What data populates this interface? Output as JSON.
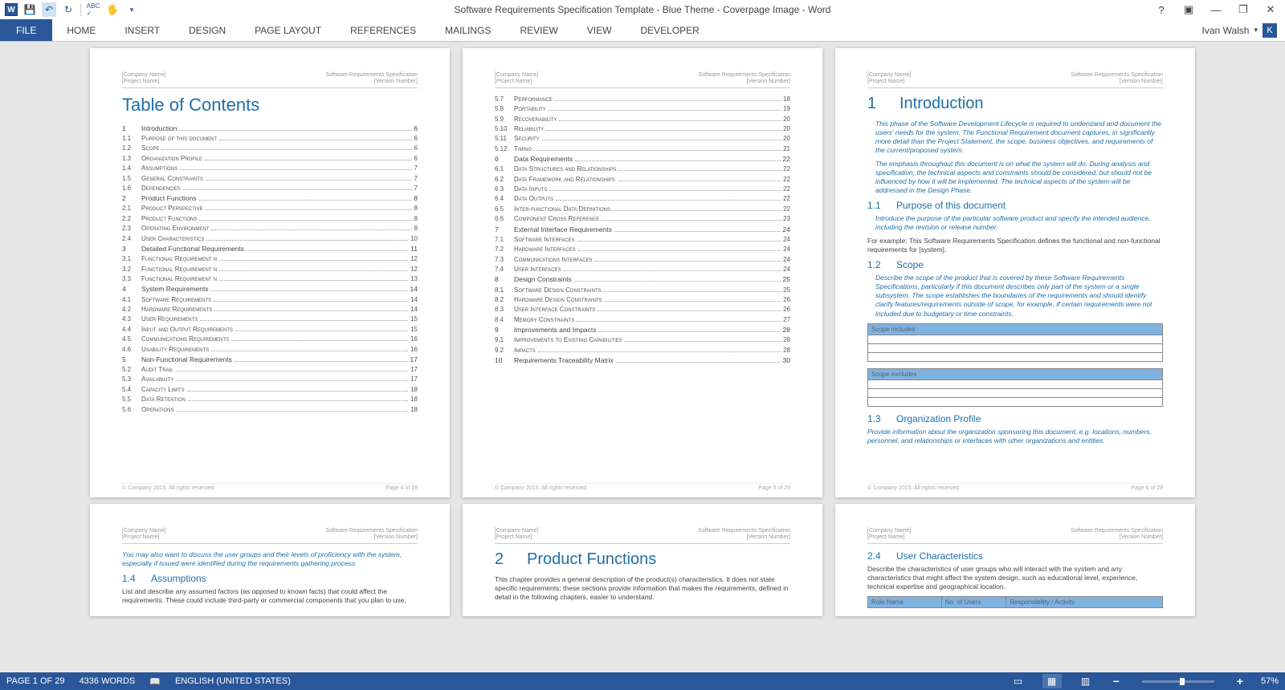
{
  "title": "Software Requirements Specification Template - Blue Theme - Coverpage Image - Word",
  "user": "Ivan Walsh",
  "user_initial": "K",
  "ribbon_tabs": [
    "FILE",
    "HOME",
    "INSERT",
    "DESIGN",
    "PAGE LAYOUT",
    "REFERENCES",
    "MAILINGS",
    "REVIEW",
    "VIEW",
    "DEVELOPER"
  ],
  "header_company": "[Company Name]",
  "header_project": "[Project Name]",
  "header_doc": "Software Requirements Specification",
  "header_version": "[Version Number]",
  "footer_copyright": "© Company 2015. All rights reserved",
  "footer_p4": "Page 4 of 29",
  "footer_p5": "Page 5 of 29",
  "footer_p6": "Page 6 of 29",
  "toc_title": "Table of Contents",
  "toc1": [
    {
      "h": 1,
      "no": "1",
      "lbl": "Introduction",
      "pg": "6"
    },
    {
      "h": 2,
      "no": "1.1",
      "lbl": "Purpose of this document",
      "pg": "6"
    },
    {
      "h": 2,
      "no": "1.2",
      "lbl": "Scope",
      "pg": "6"
    },
    {
      "h": 2,
      "no": "1.3",
      "lbl": "Organization Profile",
      "pg": "6"
    },
    {
      "h": 2,
      "no": "1.4",
      "lbl": "Assumptions",
      "pg": "7"
    },
    {
      "h": 2,
      "no": "1.5",
      "lbl": "General Constraints",
      "pg": "7"
    },
    {
      "h": 2,
      "no": "1.6",
      "lbl": "Dependencies",
      "pg": "7"
    },
    {
      "h": 1,
      "no": "2",
      "lbl": "Product Functions",
      "pg": "8"
    },
    {
      "h": 2,
      "no": "2.1",
      "lbl": "Product Perspective",
      "pg": "8"
    },
    {
      "h": 2,
      "no": "2.2",
      "lbl": "Product Functions",
      "pg": "8"
    },
    {
      "h": 2,
      "no": "2.3",
      "lbl": "Operating Environment",
      "pg": "8"
    },
    {
      "h": 2,
      "no": "2.4",
      "lbl": "User Characteristics",
      "pg": "10"
    },
    {
      "h": 1,
      "no": "3",
      "lbl": "Detailed Functional Requirements",
      "pg": "11"
    },
    {
      "h": 2,
      "no": "3.1",
      "lbl": "Functional Requirement n",
      "pg": "12"
    },
    {
      "h": 2,
      "no": "3.2",
      "lbl": "Functional Requirement n",
      "pg": "12"
    },
    {
      "h": 2,
      "no": "3.3",
      "lbl": "Functional Requirement n",
      "pg": "13"
    },
    {
      "h": 1,
      "no": "4",
      "lbl": "System Requirements",
      "pg": "14"
    },
    {
      "h": 2,
      "no": "4.1",
      "lbl": "Software Requirements",
      "pg": "14"
    },
    {
      "h": 2,
      "no": "4.2",
      "lbl": "Hardware Requirements",
      "pg": "14"
    },
    {
      "h": 2,
      "no": "4.3",
      "lbl": "User Requirements",
      "pg": "15"
    },
    {
      "h": 2,
      "no": "4.4",
      "lbl": "Input and Output Requirements",
      "pg": "15"
    },
    {
      "h": 2,
      "no": "4.5",
      "lbl": "Communications Requirements",
      "pg": "16"
    },
    {
      "h": 2,
      "no": "4.6",
      "lbl": "Usability Requirements",
      "pg": "16"
    },
    {
      "h": 1,
      "no": "5",
      "lbl": "Non-Functional Requirements",
      "pg": "17"
    },
    {
      "h": 2,
      "no": "5.2",
      "lbl": "Audit Trail",
      "pg": "17"
    },
    {
      "h": 2,
      "no": "5.3",
      "lbl": "Availability",
      "pg": "17"
    },
    {
      "h": 2,
      "no": "5.4",
      "lbl": "Capacity Limits",
      "pg": "18"
    },
    {
      "h": 2,
      "no": "5.5",
      "lbl": "Data Retention",
      "pg": "18"
    },
    {
      "h": 2,
      "no": "5.6",
      "lbl": "Operations",
      "pg": "18"
    }
  ],
  "toc2": [
    {
      "h": 2,
      "no": "5.7",
      "lbl": "Performance",
      "pg": "18"
    },
    {
      "h": 2,
      "no": "5.8",
      "lbl": "Portability",
      "pg": "19"
    },
    {
      "h": 2,
      "no": "5.9",
      "lbl": "Recoverability",
      "pg": "20"
    },
    {
      "h": 2,
      "no": "5.10",
      "lbl": "Reliability",
      "pg": "20"
    },
    {
      "h": 2,
      "no": "5.11",
      "lbl": "Security",
      "pg": "20"
    },
    {
      "h": 2,
      "no": "5.12",
      "lbl": "Timing",
      "pg": "21"
    },
    {
      "h": 1,
      "no": "6",
      "lbl": "Data Requirements",
      "pg": "22"
    },
    {
      "h": 2,
      "no": "6.1",
      "lbl": "Data Structures and Relationships",
      "pg": "22"
    },
    {
      "h": 2,
      "no": "6.2",
      "lbl": "Data Framework and Relationships",
      "pg": "22"
    },
    {
      "h": 2,
      "no": "6.3",
      "lbl": "Data Inputs",
      "pg": "22"
    },
    {
      "h": 2,
      "no": "6.4",
      "lbl": "Data Outputs",
      "pg": "22"
    },
    {
      "h": 2,
      "no": "6.5",
      "lbl": "Inter-functional Data Definitions",
      "pg": "22"
    },
    {
      "h": 2,
      "no": "6.6",
      "lbl": "Component Cross Reference",
      "pg": "23"
    },
    {
      "h": 1,
      "no": "7",
      "lbl": "External Interface Requirements",
      "pg": "24"
    },
    {
      "h": 2,
      "no": "7.1",
      "lbl": "Software Interfaces",
      "pg": "24"
    },
    {
      "h": 2,
      "no": "7.2",
      "lbl": "Hardware Interfaces",
      "pg": "24"
    },
    {
      "h": 2,
      "no": "7.3",
      "lbl": "Communications Interfaces",
      "pg": "24"
    },
    {
      "h": 2,
      "no": "7.4",
      "lbl": "User Interfaces",
      "pg": "24"
    },
    {
      "h": 1,
      "no": "8",
      "lbl": "Design Constraints",
      "pg": "25"
    },
    {
      "h": 2,
      "no": "8.1",
      "lbl": "Software Design Constraints",
      "pg": "25"
    },
    {
      "h": 2,
      "no": "8.2",
      "lbl": "Hardware Design Constraints",
      "pg": "26"
    },
    {
      "h": 2,
      "no": "8.3",
      "lbl": "User Interface Constraints",
      "pg": "26"
    },
    {
      "h": 2,
      "no": "8.4",
      "lbl": "Memory Constraints",
      "pg": "27"
    },
    {
      "h": 1,
      "no": "9",
      "lbl": "Improvements and Impacts",
      "pg": "28"
    },
    {
      "h": 2,
      "no": "9.1",
      "lbl": "Improvements to Existing Capabilities",
      "pg": "28"
    },
    {
      "h": 2,
      "no": "9.2",
      "lbl": "Impacts",
      "pg": "28"
    },
    {
      "h": 1,
      "no": "10",
      "lbl": "Requirements Traceability Matrix",
      "pg": "30"
    }
  ],
  "intro": {
    "title": "Introduction",
    "p1": "This phase of the Software Development Lifecycle is required to understand and document the users' needs for the system. The Functional Requirement document captures, in significantly more detail than the Project Statement, the scope, business objectives, and requirements of the current/proposed system.",
    "p2": "The emphasis throughout this document is on what the system will do. During analysis and specification, the technical aspects and constraints should be considered, but should not be influenced by how it will be implemented. The technical aspects of the system will be addressed in the Design Phase.",
    "s11": "Purpose of this document",
    "s11_p": "Introduce the purpose of the particular software product and specify the intended audience, including the revision or release number.",
    "s11_ex": "For example: This Software Requirements Specification defines the functional and non-functional requirements for [system].",
    "s12": "Scope",
    "s12_p": "Describe the scope of the product that is covered by these Software Requirements Specifications, particularly if this document describes only part of the system or a single subsystem. The scope establishes the boundaries of the requirements and should identify clarify features/requirements outside of scope, for example, if certain requirements were not included due to budgetary or time constraints.",
    "scope_inc": "Scope includes",
    "scope_exc": "Scope excludes",
    "s13": "Organization Profile",
    "s13_p": "Provide information about the organization sponsoring this document, e.g. locations, numbers, personnel, and relationships or interfaces with other organizations and entities."
  },
  "row2": {
    "p1_l1": "You may also want to discuss the user groups and their levels of proficiency with the system, especially if issued were identified during the requirements gathering process.",
    "s14": "Assumptions",
    "s14_p": "List and describe any assumed factors (as opposed to known facts) that could affect the requirements. These could include third-party or commercial components that you plan to use,",
    "p2_num": "2",
    "p2_title": "Product Functions",
    "p2_body": "This chapter provides a general description of the product(s) characteristics. It does not state specific requirements; these sections provide information that makes the requirements, defined in detail in the following chapters, easier to understand.",
    "s24": "User Characteristics",
    "s24_p": "Describe the characteristics of user groups who will interact with the system and any characteristics that might affect the system design, such as educational level, experience, technical expertise and geographical location.",
    "th1": "Role Name",
    "th2": "No. of Users",
    "th3": "Responsibility / Activity"
  },
  "status": {
    "page": "PAGE 1 OF 29",
    "words": "4336 WORDS",
    "lang": "ENGLISH (UNITED STATES)",
    "zoom": "57%"
  }
}
